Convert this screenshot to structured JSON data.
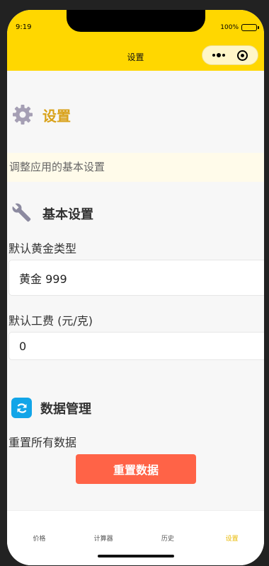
{
  "status": {
    "time": "9:19",
    "battery": "100%"
  },
  "nav": {
    "title": "设置"
  },
  "page": {
    "title": "设置",
    "intro": "调整应用的基本设置",
    "icon": "gear-icon",
    "accent_color": "#d9a21a"
  },
  "basic_settings": {
    "title": "基本设置",
    "icon": "wrench-icon",
    "gold_type_label": "默认黄金类型",
    "gold_type_value": "黄金 999",
    "labor_fee_label": "默认工费 (元/克)",
    "labor_fee_value": "0"
  },
  "data_management": {
    "title": "数据管理",
    "icon": "refresh-icon",
    "reset_label": "重置所有数据",
    "reset_button": "重置数据",
    "reset_button_color": "#ff6347"
  },
  "tabs": [
    {
      "label": "价格",
      "active": false
    },
    {
      "label": "计算器",
      "active": false
    },
    {
      "label": "历史",
      "active": false
    },
    {
      "label": "设置",
      "active": true
    }
  ],
  "theme": {
    "brand_yellow": "#ffd700",
    "active_tab_color": "#e8b800"
  }
}
